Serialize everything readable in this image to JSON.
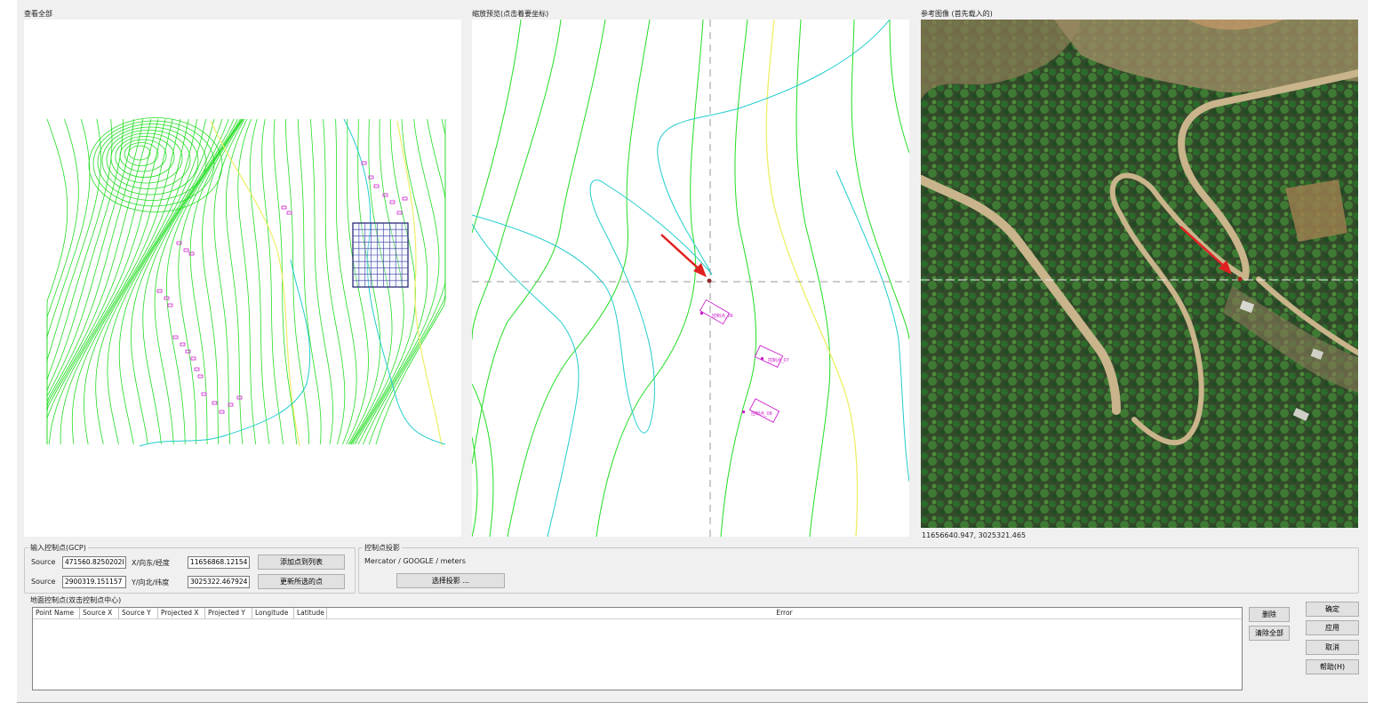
{
  "panels": {
    "overview_title": "查看全部",
    "zoom_title": "缩放预览(点击着要坐标)",
    "reference_title": "参考图像 (首先载入的)",
    "zoom_point_labels": [
      "控制点_06",
      "控制点_07",
      "控制点_08"
    ],
    "coord_readout": "11656640.947, 3025321.465"
  },
  "gcp_input": {
    "title": "输入控制点(GCP)",
    "rows": [
      {
        "label": "Source",
        "source_value": "471560.8250202I",
        "axis_label": "X/向东/经度",
        "target_value": "11656868.12154"
      },
      {
        "label": "Source",
        "source_value": "2900319.151157",
        "axis_label": "Y/向北/纬度",
        "target_value": "3025322.467924"
      }
    ],
    "add_button": "添加点到列表",
    "update_button": "更新所选的点"
  },
  "projection": {
    "title": "控制点投影",
    "value": "Mercator / GOOGLE / meters",
    "select_button": "选择投影 ..."
  },
  "gcp_list": {
    "title": "地面控制点(双击控制点中心)",
    "columns": [
      "Point Name",
      "Source X",
      "Source Y",
      "Projected X",
      "Projected Y",
      "Longitude",
      "Latitude",
      "Error"
    ],
    "rows": []
  },
  "list_buttons": {
    "delete": "删除",
    "remove_all": "清除全部"
  },
  "dialog_buttons": {
    "ok": "确定",
    "apply": "应用",
    "cancel": "取消",
    "help": "帮助(H)"
  },
  "colors": {
    "contour_green": "#22dd22",
    "contour_cyan": "#22cccc",
    "contour_yellow": "#eeee66",
    "marker_magenta": "#cc22cc",
    "arrow_red": "#e02020"
  }
}
